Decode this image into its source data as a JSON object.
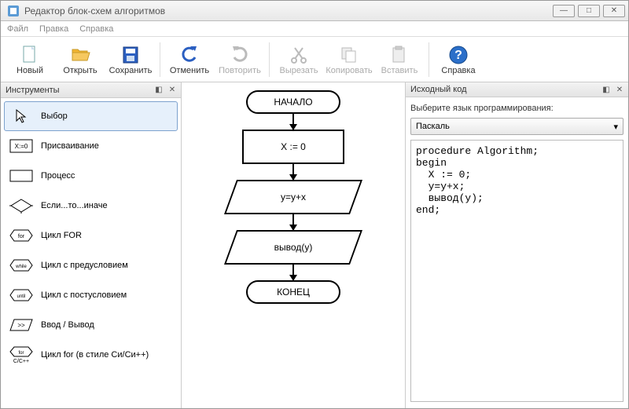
{
  "window": {
    "title": "Редактор блок-схем алгоритмов"
  },
  "menu": {
    "file": "Файл",
    "edit": "Правка",
    "help": "Справка"
  },
  "toolbar": {
    "new": "Новый",
    "open": "Открыть",
    "save": "Сохранить",
    "undo": "Отменить",
    "redo": "Повторить",
    "cut": "Вырезать",
    "copy": "Копировать",
    "paste": "Вставить",
    "help": "Справка"
  },
  "tools_panel": {
    "title": "Инструменты",
    "items": [
      {
        "label": "Выбор"
      },
      {
        "label": "Присваивание"
      },
      {
        "label": "Процесс"
      },
      {
        "label": "Если...то...иначе"
      },
      {
        "label": "Цикл FOR"
      },
      {
        "label": "Цикл с предусловием"
      },
      {
        "label": "Цикл с постусловием"
      },
      {
        "label": "Ввод / Вывод"
      },
      {
        "label": "Цикл for (в стиле Си/Си++)"
      }
    ]
  },
  "flow": {
    "start": "НАЧАЛО",
    "assign": "X := 0",
    "proc": "y=y+x",
    "io": "вывод(y)",
    "end": "КОНЕЦ"
  },
  "code_panel": {
    "title": "Исходный код",
    "lang_label": "Выберите язык программирования:",
    "lang_selected": "Паскаль",
    "code": "procedure Algorithm;\nbegin\n  X := 0;\n  y=y+x;\n  вывод(y);\nend;"
  }
}
